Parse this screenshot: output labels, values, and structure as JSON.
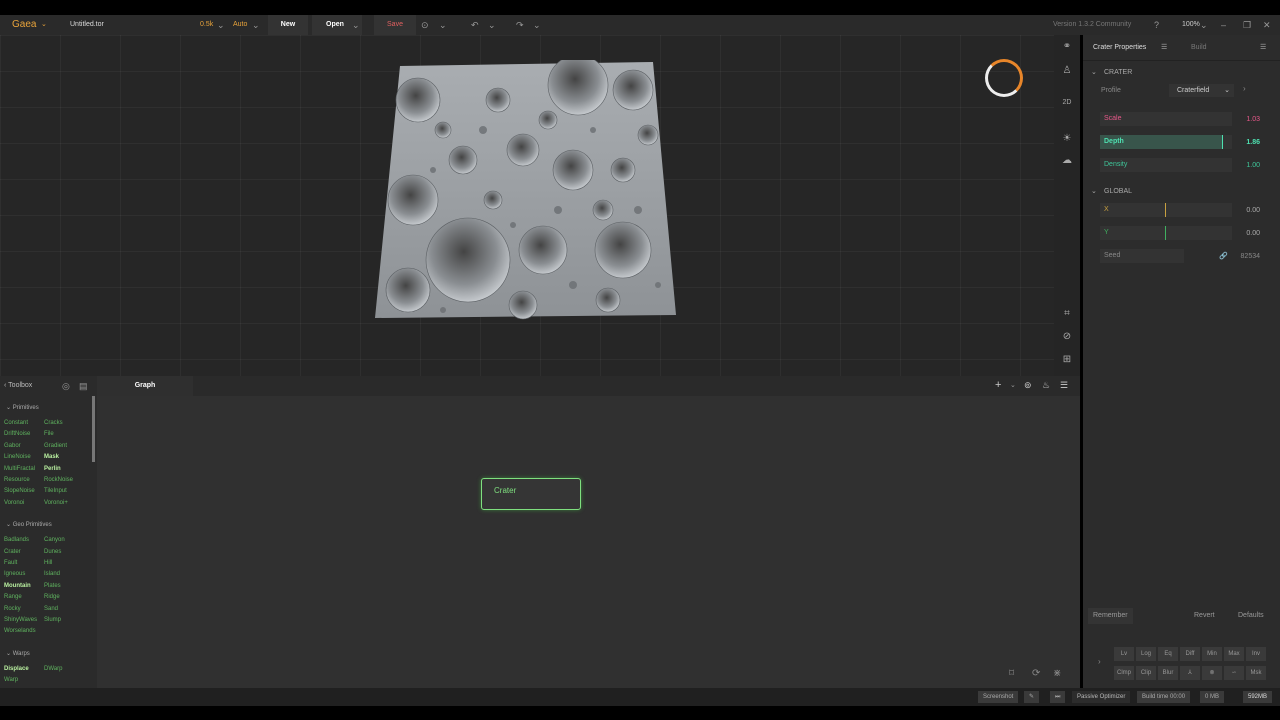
{
  "topbar": {
    "logo": "Gaea",
    "filename": "Untitled.tor",
    "resolution": "0.5k",
    "auto": "Auto",
    "new_label": "New",
    "open_label": "Open",
    "save_label": "Save",
    "version": "Version 1.3.2 Community",
    "zoom": "100%"
  },
  "side_tools": {
    "label_2d": "2D"
  },
  "properties": {
    "tab_active": "Crater Properties",
    "tab_build": "Build",
    "section_crater": "CRATER",
    "profile_label": "Profile",
    "profile_value": "Craterfield",
    "params": [
      {
        "label": "Scale",
        "value": "1.03",
        "fraction": 0.0,
        "color": "#e8588a"
      },
      {
        "label": "Depth",
        "value": "1.86",
        "fraction": 0.93,
        "color": "#4ee0b0"
      },
      {
        "label": "Density",
        "value": "1.00",
        "fraction": 0.0,
        "color": "#3ec79a"
      }
    ],
    "section_global": "GLOBAL",
    "globals": [
      {
        "label": "X",
        "value": "0.00",
        "fraction": 0.5,
        "color": "#c8a040"
      },
      {
        "label": "Y",
        "value": "0.00",
        "fraction": 0.5,
        "color": "#40b060"
      }
    ],
    "seed_label": "Seed",
    "seed_value": "82534",
    "remember": "Remember",
    "revert": "Revert",
    "defaults": "Defaults",
    "mini_row1": [
      "Lv",
      "Log",
      "Eq",
      "Diff",
      "Min",
      "Max",
      "Inv"
    ],
    "mini_row2": [
      "Clmp",
      "Clip",
      "Blur",
      "⅄",
      "⊗",
      "∽",
      "Msk"
    ]
  },
  "toolbox": {
    "title": "Toolbox",
    "categories": [
      {
        "name": "Primitives",
        "nodes": [
          [
            "Constant",
            "Cracks"
          ],
          [
            "DriftNoise",
            "File"
          ],
          [
            "Gabor",
            "Gradient"
          ],
          [
            "LineNoise",
            "Mask"
          ],
          [
            "MultiFractal",
            "Perlin"
          ],
          [
            "Resource",
            "RockNoise"
          ],
          [
            "SlopeNoise",
            "TileInput"
          ],
          [
            "Voronoi",
            "Voronoi+"
          ]
        ]
      },
      {
        "name": "Geo Primitives",
        "nodes": [
          [
            "Badlands",
            "Canyon"
          ],
          [
            "Crater",
            "Dunes"
          ],
          [
            "Fault",
            "Hill"
          ],
          [
            "Igneous",
            "Island"
          ],
          [
            "Mountain",
            "Plates"
          ],
          [
            "Range",
            "Ridge"
          ],
          [
            "Rocky",
            "Sand"
          ],
          [
            "ShinyWaves",
            "Slump"
          ],
          [
            "Worselands",
            ""
          ]
        ]
      },
      {
        "name": "Warps",
        "nodes": [
          [
            "Displace",
            "DWarp"
          ],
          [
            "Warp",
            ""
          ]
        ]
      }
    ],
    "bright_nodes": [
      "Mask",
      "Perlin",
      "Mountain",
      "Displace"
    ]
  },
  "graph": {
    "tab": "Graph",
    "node_label": "Crater"
  },
  "status": {
    "screenshot": "Screenshot",
    "optimizer": "Passive Optimizer",
    "build_time": "Build time 00:00",
    "mem1": "0 MB",
    "mem2": "592MB"
  }
}
